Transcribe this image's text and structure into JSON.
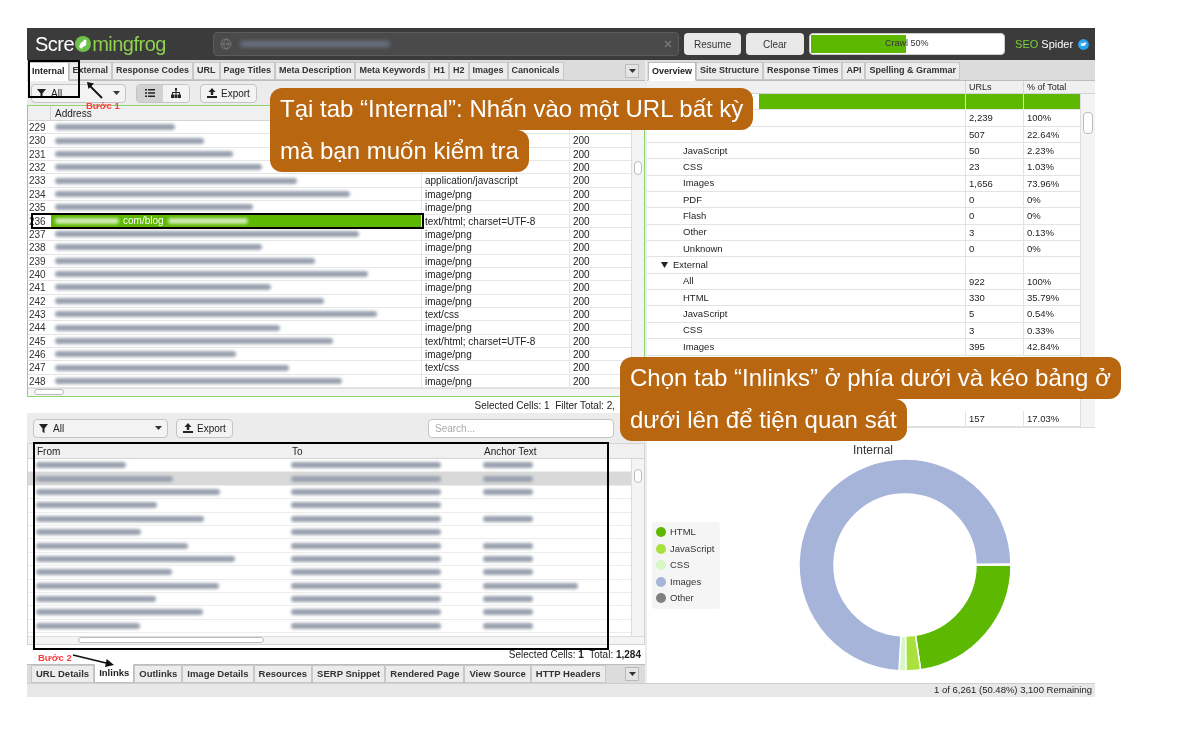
{
  "app": {
    "logo": [
      "Scre",
      "mingfrog"
    ],
    "buttons": [
      "Resume",
      "Clear"
    ],
    "progress": {
      "label": "Crawl 50%",
      "level": 0.49
    },
    "product": [
      "SEO",
      "Spider"
    ]
  },
  "left_tabs": [
    {
      "label": "Internal",
      "selected": true
    },
    {
      "label": "External",
      "selected": false
    },
    {
      "label": "Response Codes",
      "selected": false
    },
    {
      "label": "URL",
      "selected": false
    },
    {
      "label": "Page Titles",
      "selected": false
    },
    {
      "label": "Meta Description",
      "selected": false
    },
    {
      "label": "Meta Keywords",
      "selected": false
    },
    {
      "label": "H1",
      "selected": false
    },
    {
      "label": "H2",
      "selected": false
    },
    {
      "label": "Images",
      "selected": false
    },
    {
      "label": "Canonicals",
      "selected": false
    }
  ],
  "left_toolbar": {
    "filter": "All",
    "views": [
      {
        "kind": "list",
        "selected": true
      },
      {
        "kind": "tree",
        "selected": false
      }
    ],
    "export": "Export"
  },
  "internal_table": {
    "columns": [
      "Address"
    ],
    "rows": [
      {
        "number": "229",
        "selected": false
      },
      {
        "number": "230",
        "status": "200",
        "selected": false
      },
      {
        "number": "231",
        "status": "200",
        "selected": false
      },
      {
        "number": "232",
        "status": "200",
        "selected": false
      },
      {
        "number": "233",
        "type": "application/javascript",
        "status": "200",
        "selected": false
      },
      {
        "number": "234",
        "type": "image/png",
        "status": "200",
        "selected": false
      },
      {
        "number": "235",
        "type": "image/png",
        "status": "200",
        "selected": false
      },
      {
        "number": "236",
        "address": "com/blog",
        "type": "text/html; charset=UTF-8",
        "status": "200",
        "selected": true
      },
      {
        "number": "237",
        "type": "image/png",
        "status": "200",
        "selected": false
      },
      {
        "number": "238",
        "type": "image/png",
        "status": "200",
        "selected": false
      },
      {
        "number": "239",
        "type": "image/png",
        "status": "200",
        "selected": false
      },
      {
        "number": "240",
        "type": "image/png",
        "status": "200",
        "selected": false
      },
      {
        "number": "241",
        "type": "image/png",
        "status": "200",
        "selected": false
      },
      {
        "number": "242",
        "type": "image/png",
        "status": "200",
        "selected": false
      },
      {
        "number": "243",
        "type": "text/css",
        "status": "200",
        "selected": false
      },
      {
        "number": "244",
        "type": "image/png",
        "status": "200",
        "selected": false
      },
      {
        "number": "245",
        "type": "text/html; charset=UTF-8",
        "status": "200",
        "selected": false
      },
      {
        "number": "246",
        "type": "image/png",
        "status": "200",
        "selected": false
      },
      {
        "number": "247",
        "type": "text/css",
        "status": "200",
        "selected": false
      },
      {
        "number": "248",
        "type": "image/png",
        "status": "200",
        "selected": false
      }
    ],
    "status_text": "Selected Cells: 1  Filter Total: 2,"
  },
  "inlinks": {
    "filter": "All",
    "export": "Export",
    "search_placeholder": "Search...",
    "columns": [
      "From",
      "To",
      "Anchor Text"
    ],
    "rows": [
      {
        "selected": false,
        "has_anchor": true
      },
      {
        "selected": true,
        "has_anchor": true
      },
      {
        "selected": false,
        "has_anchor": true
      },
      {
        "selected": false,
        "has_anchor": false
      },
      {
        "selected": false,
        "has_anchor": true
      },
      {
        "selected": false,
        "has_anchor": false
      },
      {
        "selected": false,
        "has_anchor": true
      },
      {
        "selected": false,
        "has_anchor": true
      },
      {
        "selected": false,
        "has_anchor": true
      },
      {
        "selected": false,
        "has_anchor": true
      },
      {
        "selected": false,
        "has_anchor": true
      },
      {
        "selected": false,
        "has_anchor": true
      },
      {
        "selected": false,
        "has_anchor": true
      }
    ],
    "status_text": "Selected Cells: **1**  Total: **1,284**"
  },
  "bottom_tabs": [
    {
      "label": "URL Details",
      "selected": false
    },
    {
      "label": "Inlinks",
      "selected": true
    },
    {
      "label": "Outlinks",
      "selected": false
    },
    {
      "label": "Image Details",
      "selected": false
    },
    {
      "label": "Resources",
      "selected": false
    },
    {
      "label": "SERP Snippet",
      "selected": false
    },
    {
      "label": "Rendered Page",
      "selected": false
    },
    {
      "label": "View Source",
      "selected": false
    },
    {
      "label": "HTTP Headers",
      "selected": false
    }
  ],
  "right_tabs": [
    {
      "label": "Overview",
      "selected": true
    },
    {
      "label": "Site Structure",
      "selected": false
    },
    {
      "label": "Response Times",
      "selected": false
    },
    {
      "label": "API",
      "selected": false
    },
    {
      "label": "Spelling & Grammar",
      "selected": false
    }
  ],
  "overview": {
    "columns": [
      "URLs",
      "% of Total"
    ],
    "groups": [
      {
        "selected": true,
        "children": [
          {
            "urls": "2,239",
            "percent": "100%"
          },
          {
            "urls": "507",
            "percent": "22.64%"
          },
          {
            "label": "JavaScript",
            "urls": "50",
            "percent": "2.23%"
          },
          {
            "label": "CSS",
            "urls": "23",
            "percent": "1.03%"
          },
          {
            "label": "Images",
            "urls": "1,656",
            "percent": "73.96%"
          },
          {
            "label": "PDF",
            "urls": "0",
            "percent": "0%"
          },
          {
            "label": "Flash",
            "urls": "0",
            "percent": "0%"
          },
          {
            "label": "Other",
            "urls": "3",
            "percent": "0.13%"
          },
          {
            "label": "Unknown",
            "urls": "0",
            "percent": "0%"
          }
        ]
      },
      {
        "label": "External",
        "expanded": true,
        "selected": false,
        "children": [
          {
            "label": "All",
            "urls": "922",
            "percent": "100%"
          },
          {
            "label": "HTML",
            "urls": "330",
            "percent": "35.79%"
          },
          {
            "label": "JavaScript",
            "urls": "5",
            "percent": "0.54%"
          },
          {
            "label": "CSS",
            "urls": "3",
            "percent": "0.33%"
          },
          {
            "label": "Images",
            "urls": "395",
            "percent": "42.84%"
          },
          {
            "urls": "157",
            "percent": "17.03%"
          }
        ]
      }
    ]
  },
  "chart": {
    "chart_data": {
      "type": "donut",
      "title": "Internal",
      "categories": [
        "HTML",
        "JavaScript",
        "CSS",
        "Images",
        "Other"
      ],
      "values": [
        22.64,
        2.23,
        1.03,
        73.96,
        0.13
      ],
      "legend": true
    },
    "slices": [
      {
        "color": "#5cb800"
      },
      {
        "color": "#a8e03e"
      },
      {
        "color": "#d6f7c6"
      },
      {
        "color": "#a6b4da"
      },
      {
        "color": "#808080"
      }
    ]
  },
  "crawl_status": "1 of 6,261 (50.48%) 3,100 Remaining",
  "annotations": {
    "steps": [
      "Bước 1",
      "Bước 2"
    ],
    "callouts": [
      {
        "lines": [
          "Tại tab “Internal”: Nhấn vào một URL bất kỳ",
          "mà bạn muốn kiểm tra"
        ]
      },
      {
        "lines": [
          "Chọn tab “Inlinks” ở phía dưới và kéo bảng ở",
          "dưới lên để tiện quan sát"
        ]
      }
    ]
  }
}
